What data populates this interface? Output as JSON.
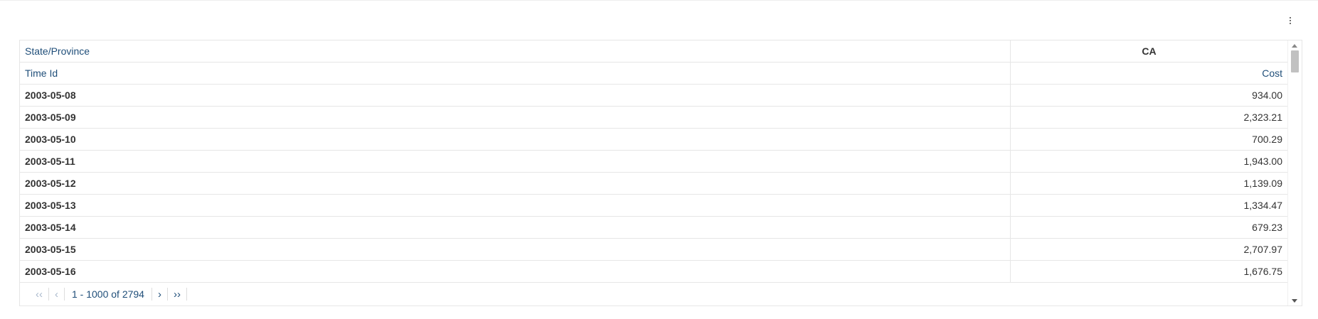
{
  "table": {
    "header_row_1": {
      "label": "State/Province",
      "value": "CA"
    },
    "header_row_2": {
      "label": "Time Id",
      "value": "Cost"
    },
    "rows": [
      {
        "time_id": "2003-05-08",
        "cost": "934.00"
      },
      {
        "time_id": "2003-05-09",
        "cost": "2,323.21"
      },
      {
        "time_id": "2003-05-10",
        "cost": "700.29"
      },
      {
        "time_id": "2003-05-11",
        "cost": "1,943.00"
      },
      {
        "time_id": "2003-05-12",
        "cost": "1,139.09"
      },
      {
        "time_id": "2003-05-13",
        "cost": "1,334.47"
      },
      {
        "time_id": "2003-05-14",
        "cost": "679.23"
      },
      {
        "time_id": "2003-05-15",
        "cost": "2,707.97"
      },
      {
        "time_id": "2003-05-16",
        "cost": "1,676.75"
      }
    ]
  },
  "pager": {
    "first_glyph": "‹‹",
    "prev_glyph": "‹",
    "range_label": "1 - 1000 of 2794",
    "next_glyph": "›",
    "last_glyph": "››"
  },
  "icons": {
    "menu": "kebab-menu-icon",
    "scroll_up": "scroll-up-arrow-icon",
    "scroll_down": "scroll-down-arrow-icon"
  },
  "colors": {
    "header_text": "#1f4e79",
    "border": "#e6e6e6",
    "disabled_pager": "#a9b9cc"
  }
}
